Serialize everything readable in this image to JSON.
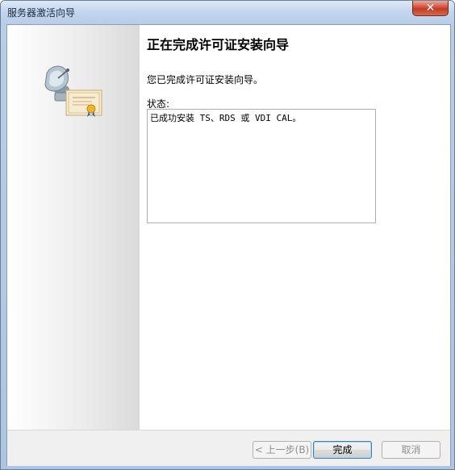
{
  "window": {
    "title": "服务器激活向导",
    "close_glyph": "✕"
  },
  "sidebar": {
    "icon": "satellite-certificate-icon"
  },
  "page": {
    "heading": "正在完成许可证安装向导",
    "description": "您已完成许可证安装向导。",
    "status_label": "状态:",
    "status_text": "已成功安装 TS、RDS 或 VDI CAL。"
  },
  "buttons": {
    "back": "< 上一步(B)",
    "finish": "完成",
    "cancel": "取消"
  },
  "colors": {
    "titlebar": "#c3d6ee",
    "close": "#c23a23",
    "footer": "#f0f0f0",
    "default_button_border": "#3c7fb1"
  }
}
